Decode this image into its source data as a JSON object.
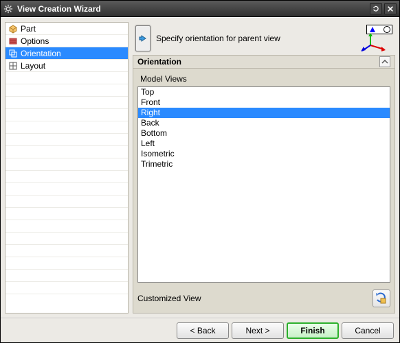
{
  "title": "View Creation Wizard",
  "sidebar": {
    "items": [
      {
        "label": "Part"
      },
      {
        "label": "Options"
      },
      {
        "label": "Orientation"
      },
      {
        "label": "Layout"
      }
    ],
    "selected_index": 2
  },
  "instruction": "Specify orientation for parent view",
  "section": {
    "title": "Orientation"
  },
  "model_views": {
    "title": "Model Views",
    "items": [
      "Top",
      "Front",
      "Right",
      "Back",
      "Bottom",
      "Left",
      "Isometric",
      "Trimetric"
    ],
    "selected_index": 2
  },
  "customized_view_label": "Customized View",
  "buttons": {
    "back": "< Back",
    "next": "Next >",
    "finish": "Finish",
    "cancel": "Cancel"
  }
}
